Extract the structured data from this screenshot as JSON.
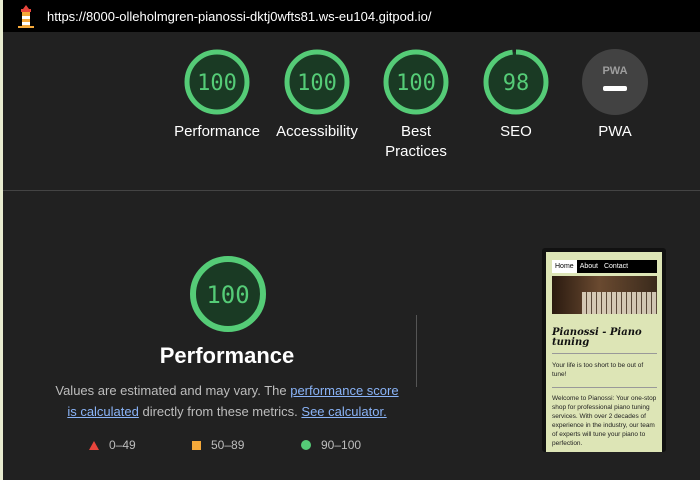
{
  "topbar": {
    "url": "https://8000-olleholmgren-pianossi-dktj0wfts81.ws-eu104.gitpod.io/",
    "logo_icon": "lighthouse-icon"
  },
  "gauges": [
    {
      "label": "Performance",
      "score": "100",
      "value": 100
    },
    {
      "label": "Accessibility",
      "score": "100",
      "value": 100
    },
    {
      "label": "Best Practices",
      "score": "100",
      "value": 100
    },
    {
      "label": "SEO",
      "score": "98",
      "value": 98
    },
    {
      "label": "PWA",
      "badge": "PWA",
      "icon": "pwa-icon"
    }
  ],
  "performance": {
    "score": "100",
    "title": "Performance",
    "desc_before": "Values are estimated and may vary. The ",
    "desc_link1": "performance score is calculated",
    "desc_middle": " directly from these metrics. ",
    "desc_link2": "See calculator."
  },
  "legend": {
    "fail": "0–49",
    "average": "50–89",
    "pass": "90–100"
  },
  "thumbnail": {
    "nav": [
      "Home",
      "About",
      "Contact"
    ],
    "title": "Pianossi - Piano tuning",
    "tagline": "Your life is too short to be out of tune!",
    "body": "Welcome to Pianossi: Your one-stop shop for professional piano tuning services. With over 2 decades of experience in the industry, our team of experts will tune your piano to perfection."
  },
  "colors": {
    "pass": "#55cc77",
    "average": "#f4a83a",
    "fail": "#e8453c",
    "link": "#8ab4f8",
    "background": "#212121"
  }
}
